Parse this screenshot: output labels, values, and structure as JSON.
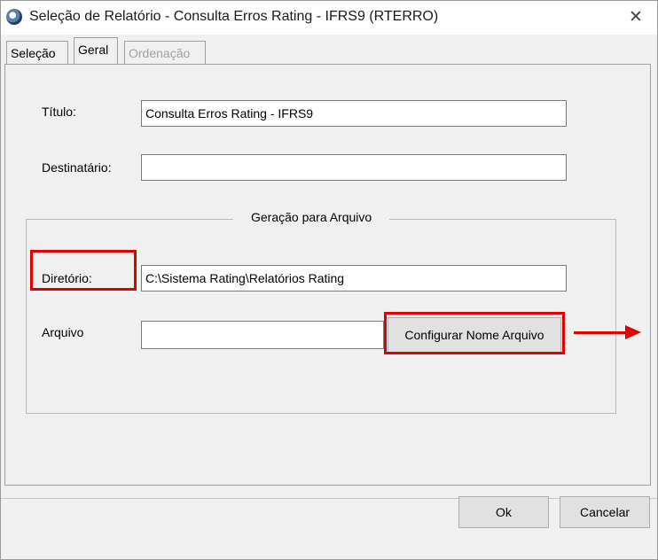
{
  "window": {
    "title": "Seleção de Relatório - Consulta Erros Rating - IFRS9 (RTERRO)",
    "close_symbol": "✕"
  },
  "tabs": [
    {
      "label": "Seleção",
      "state": "normal"
    },
    {
      "label": "Geral",
      "state": "selected"
    },
    {
      "label": "Ordenação",
      "state": "disabled"
    }
  ],
  "form": {
    "titulo_label": "Título:",
    "titulo_value": "Consulta Erros Rating - IFRS9",
    "destinatario_label": "Destinatário:",
    "destinatario_value": ""
  },
  "file_group": {
    "title": "Geração para Arquivo",
    "diretorio_label": "Diretório:",
    "diretorio_value": "C:\\Sistema Rating\\Relatórios Rating",
    "arquivo_label": "Arquivo",
    "arquivo_value": "",
    "configurar_button": "Configurar Nome Arquivo"
  },
  "footer": {
    "ok_button": "Ok",
    "cancel_button": "Cancelar"
  },
  "annotations": {
    "color": "#e00000"
  }
}
